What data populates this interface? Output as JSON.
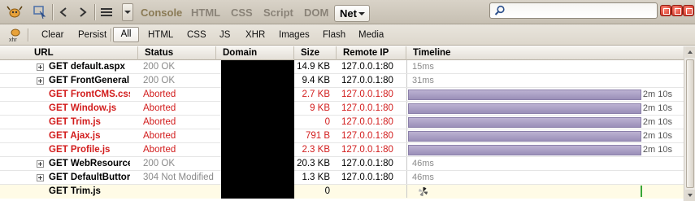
{
  "toolbar": {
    "panels": [
      "Console",
      "HTML",
      "CSS",
      "Script",
      "DOM"
    ],
    "active_panel": "Net",
    "search": {
      "value": "",
      "placeholder": ""
    }
  },
  "filterbar": {
    "clear": "Clear",
    "persist": "Persist",
    "filters": [
      "All",
      "HTML",
      "CSS",
      "JS",
      "XHR",
      "Images",
      "Flash",
      "Media"
    ]
  },
  "table": {
    "headers": {
      "url": "URL",
      "status": "Status",
      "domain": "Domain",
      "size": "Size",
      "ip": "Remote IP",
      "timeline": "Timeline"
    },
    "rows": [
      {
        "url": "GET default.aspx",
        "status": "200 OK",
        "size": "14.9 KB",
        "ip": "127.0.0.1:80",
        "timeline": "15ms"
      },
      {
        "url": "GET FrontGeneral",
        "status": "200 OK",
        "size": "9.4 KB",
        "ip": "127.0.0.1:80",
        "timeline": "31ms"
      },
      {
        "url": "GET FrontCMS.css",
        "status": "Aborted",
        "size": "2.7 KB",
        "ip": "127.0.0.1:80",
        "timeline": "2m 10s"
      },
      {
        "url": "GET Window.js",
        "status": "Aborted",
        "size": "9 KB",
        "ip": "127.0.0.1:80",
        "timeline": "2m 10s"
      },
      {
        "url": "GET Trim.js",
        "status": "Aborted",
        "size": "0",
        "ip": "127.0.0.1:80",
        "timeline": "2m 10s"
      },
      {
        "url": "GET Ajax.js",
        "status": "Aborted",
        "size": "791 B",
        "ip": "127.0.0.1:80",
        "timeline": "2m 10s"
      },
      {
        "url": "GET Profile.js",
        "status": "Aborted",
        "size": "2.3 KB",
        "ip": "127.0.0.1:80",
        "timeline": "2m 10s"
      },
      {
        "url": "GET WebResource",
        "status": "200 OK",
        "size": "20.3 KB",
        "ip": "127.0.0.1:80",
        "timeline": "46ms"
      },
      {
        "url": "GET DefaultButtor",
        "status": "304 Not Modified",
        "size": "1.3 KB",
        "ip": "127.0.0.1:80",
        "timeline": "46ms"
      },
      {
        "url": "GET Trim.js",
        "status": "",
        "size": "0",
        "ip": "",
        "timeline": ""
      }
    ]
  },
  "colors": {
    "error": "#d21c1c",
    "timeline_bar": "#a79dc2",
    "accent_close": "#c8291b"
  },
  "icons": [
    "firebug-icon",
    "inspect-icon",
    "back-icon",
    "forward-icon",
    "menu-icon",
    "search-icon",
    "minimize-icon",
    "restore-icon",
    "close-icon",
    "xhr-icon"
  ]
}
